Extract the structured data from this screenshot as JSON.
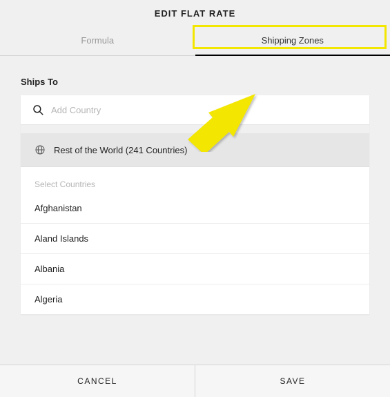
{
  "header": {
    "title": "EDIT FLAT RATE"
  },
  "tabs": {
    "formula": "Formula",
    "shipping_zones": "Shipping Zones"
  },
  "ships_to": {
    "label": "Ships To"
  },
  "search": {
    "placeholder": "Add Country"
  },
  "rest_of_world": {
    "label": "Rest of the World (241 Countries)"
  },
  "select_countries_label": "Select Countries",
  "countries": [
    "Afghanistan",
    "Aland Islands",
    "Albania",
    "Algeria"
  ],
  "footer": {
    "cancel": "CANCEL",
    "save": "SAVE"
  }
}
